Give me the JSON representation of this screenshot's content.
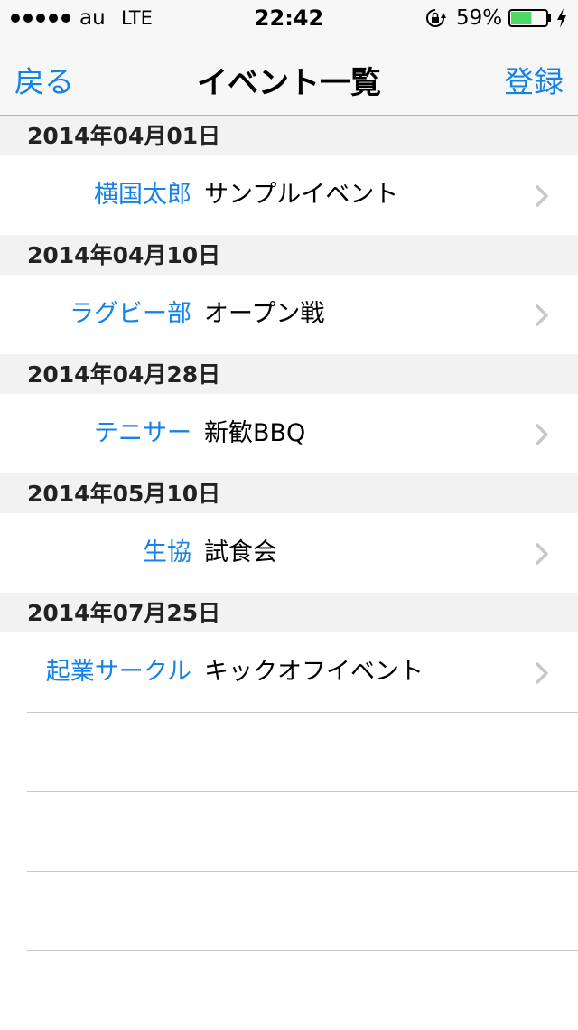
{
  "status_bar": {
    "carrier": "au",
    "network": "LTE",
    "time": "22:42",
    "battery_percent": "59%",
    "battery_level": 0.59,
    "battery_color": "#4cd964",
    "icons": [
      "signal-dots",
      "rotation-lock-icon",
      "battery-icon",
      "charging-bolt-icon"
    ]
  },
  "nav": {
    "back_label": "戻る",
    "title": "イベント一覧",
    "register_label": "登録",
    "accent_color": "#1582e6"
  },
  "sections": [
    {
      "date": "2014年04月01日",
      "rows": [
        {
          "org": "横国太郎",
          "event": "サンプルイベント"
        }
      ]
    },
    {
      "date": "2014年04月10日",
      "rows": [
        {
          "org": "ラグビー部",
          "event": "オープン戦"
        }
      ]
    },
    {
      "date": "2014年04月28日",
      "rows": [
        {
          "org": "テニサー",
          "event": "新歓BBQ"
        }
      ]
    },
    {
      "date": "2014年05月10日",
      "rows": [
        {
          "org": "生協",
          "event": "試食会"
        }
      ]
    },
    {
      "date": "2014年07月25日",
      "rows": [
        {
          "org": "起業サークル",
          "event": "キックオフイベント"
        }
      ]
    }
  ]
}
